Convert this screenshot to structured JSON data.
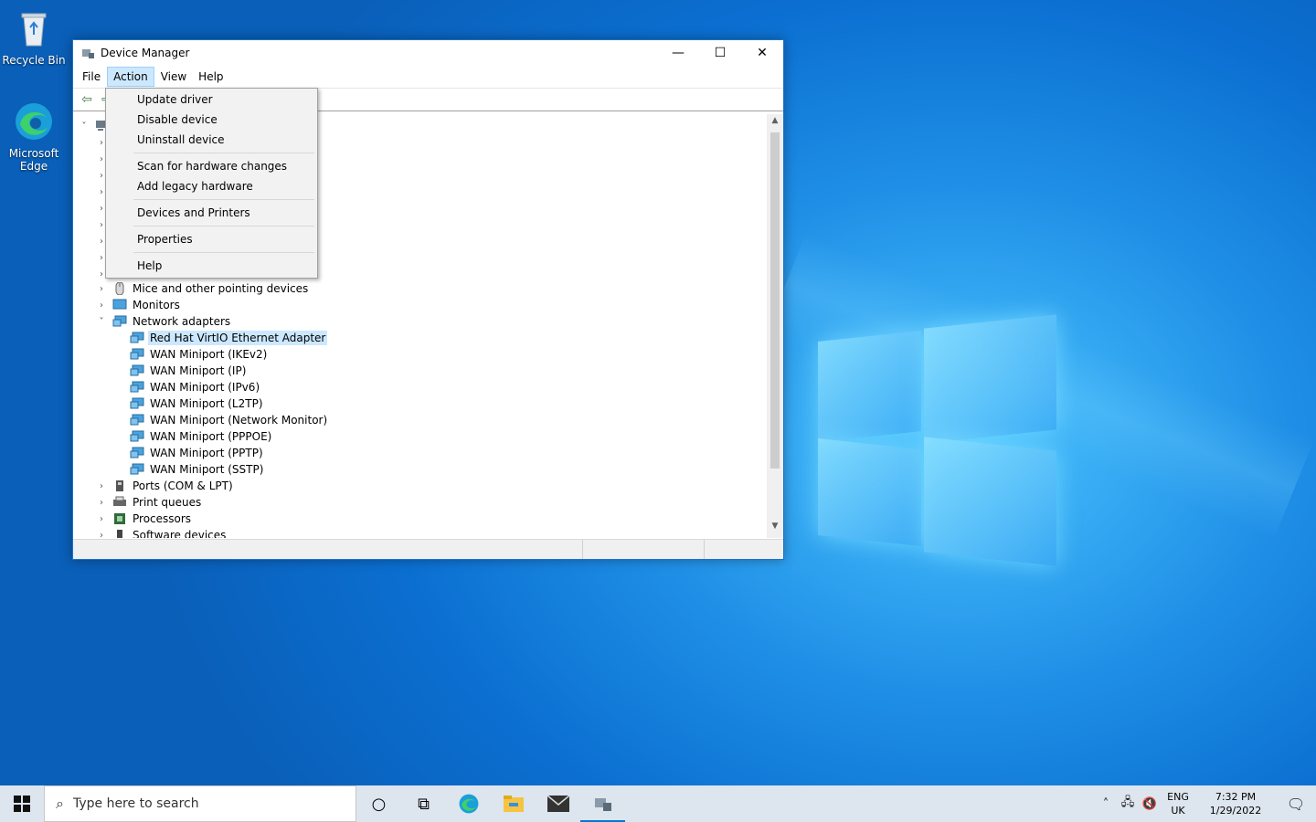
{
  "desktop": {
    "icons": [
      {
        "label": "Recycle Bin"
      },
      {
        "label": "Microsoft Edge"
      }
    ]
  },
  "window": {
    "title": "Device Manager",
    "controls": {
      "minimize": "—",
      "maximize": "☐",
      "close": "✕"
    },
    "menu": [
      "File",
      "Action",
      "View",
      "Help"
    ],
    "active_menu": "Action"
  },
  "action_menu": {
    "groups": [
      [
        "Update driver",
        "Disable device",
        "Uninstall device"
      ],
      [
        "Scan for hardware changes",
        "Add legacy hardware"
      ],
      [
        "Devices and Printers"
      ],
      [
        "Properties"
      ],
      [
        "Help"
      ]
    ]
  },
  "tree": {
    "visible_rows": [
      {
        "label": "Mice and other pointing devices",
        "level": 1,
        "expanded": false,
        "icon": "mouse-icon"
      },
      {
        "label": "Monitors",
        "level": 1,
        "expanded": false,
        "icon": "monitor-icon"
      },
      {
        "label": "Network adapters",
        "level": 1,
        "expanded": true,
        "icon": "network-adapter-icon"
      },
      {
        "label": "Red Hat VirtIO Ethernet Adapter",
        "level": 2,
        "selected": true,
        "icon": "network-adapter-icon"
      },
      {
        "label": "WAN Miniport (IKEv2)",
        "level": 2,
        "icon": "network-adapter-icon"
      },
      {
        "label": "WAN Miniport (IP)",
        "level": 2,
        "icon": "network-adapter-icon"
      },
      {
        "label": "WAN Miniport (IPv6)",
        "level": 2,
        "icon": "network-adapter-icon"
      },
      {
        "label": "WAN Miniport (L2TP)",
        "level": 2,
        "icon": "network-adapter-icon"
      },
      {
        "label": "WAN Miniport (Network Monitor)",
        "level": 2,
        "icon": "network-adapter-icon"
      },
      {
        "label": "WAN Miniport (PPPOE)",
        "level": 2,
        "icon": "network-adapter-icon"
      },
      {
        "label": "WAN Miniport (PPTP)",
        "level": 2,
        "icon": "network-adapter-icon"
      },
      {
        "label": "WAN Miniport (SSTP)",
        "level": 2,
        "icon": "network-adapter-icon"
      },
      {
        "label": "Ports (COM & LPT)",
        "level": 1,
        "expanded": false,
        "icon": "port-icon"
      },
      {
        "label": "Print queues",
        "level": 1,
        "expanded": false,
        "icon": "printer-icon"
      },
      {
        "label": "Processors",
        "level": 1,
        "expanded": false,
        "icon": "processor-icon"
      },
      {
        "label": "Software devices",
        "level": 1,
        "expanded": false,
        "icon": "software-device-icon"
      }
    ]
  },
  "taskbar": {
    "search_placeholder": "Type here to search",
    "lang_top": "ENG",
    "lang_bottom": "UK",
    "time": "7:32 PM",
    "date": "1/29/2022"
  },
  "colors": {
    "accent": "#0078d7",
    "menu_highlight": "#cce8ff",
    "selection": "#cce8ff"
  }
}
